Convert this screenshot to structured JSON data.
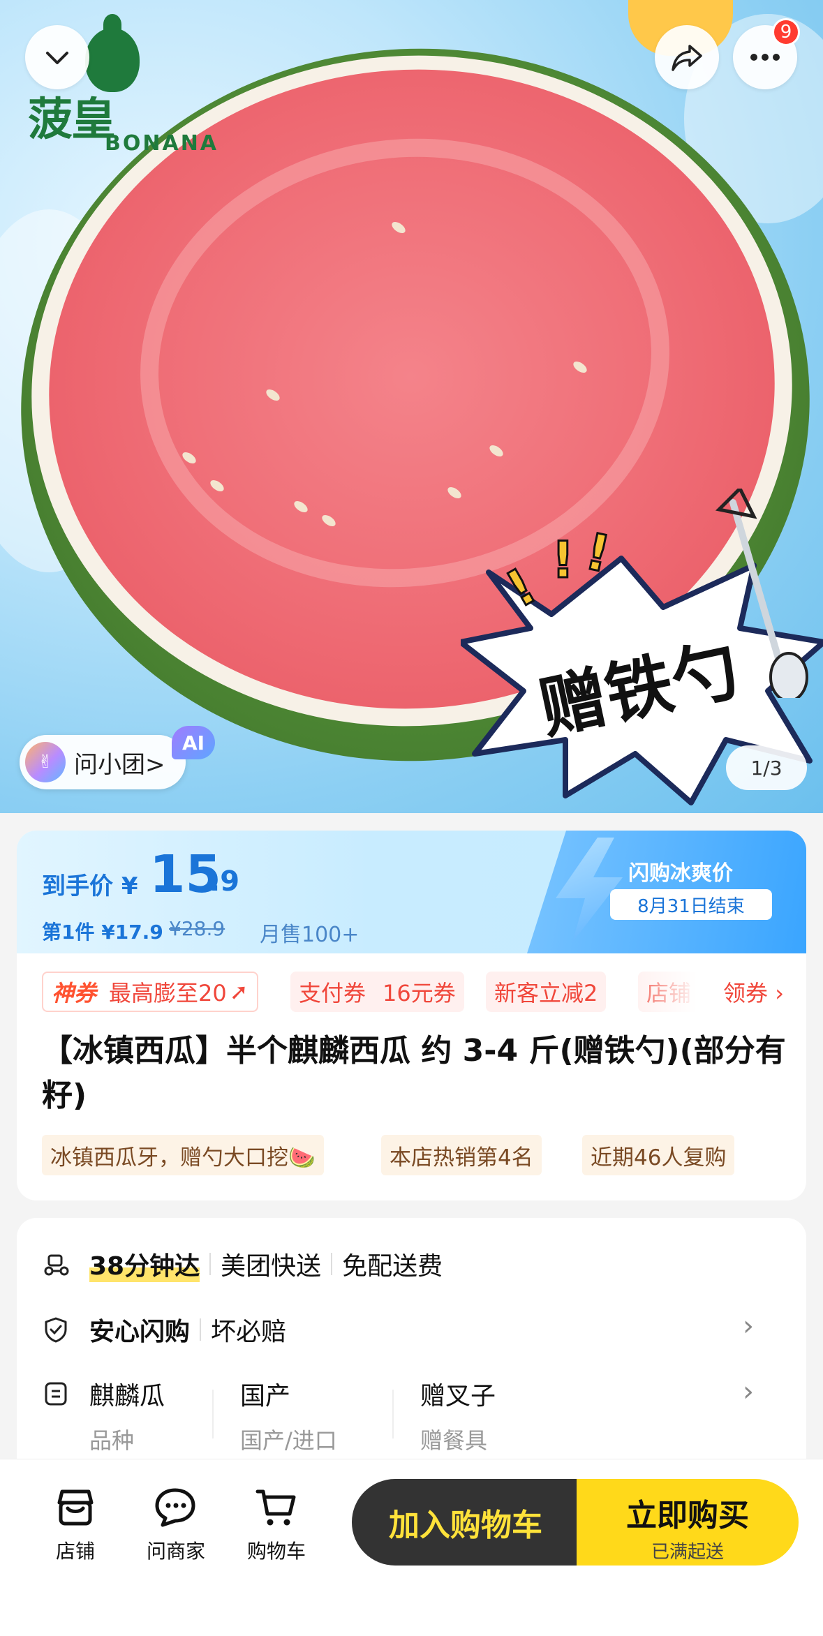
{
  "hero": {
    "brand_cn": "菠皇",
    "brand_en": "BONANA",
    "notification_count": "9",
    "promo_sticker": "赠铁勺",
    "ai_assistant_label": "问小团>",
    "ai_tag": "AI",
    "image_pager": "1/3"
  },
  "price": {
    "label": "到手价",
    "currency": "¥",
    "integer": "15",
    "decimal": ".9",
    "first_piece": "第1件 ¥17.9",
    "original": "¥28.9",
    "monthly_sales": "月售100+",
    "flash_title": "闪购冰爽价",
    "flash_end": "8月31日结束"
  },
  "coupons": {
    "god_tag": "神券",
    "god_text": "最高膨至20",
    "pay_coupon": "支付券",
    "pay_amount": "16元券",
    "new_customer": "新客立减2",
    "store": "店铺",
    "claim": "领券 ›"
  },
  "product": {
    "title": "【冰镇西瓜】半个麒麟西瓜 约 3-4 斤(赠铁勺)(部分有籽)",
    "tags": [
      "冰镇西瓜牙，赠勺大口挖🍉",
      "本店热销第4名",
      "近期46人复购"
    ]
  },
  "delivery": {
    "time": "38分钟达",
    "service": "美团快送",
    "fee": "免配送费"
  },
  "guarantee": {
    "title": "安心闪购",
    "detail": "坏必赔"
  },
  "specs": [
    {
      "value": "麒麟瓜",
      "label": "品种"
    },
    {
      "value": "国产",
      "label": "国产/进口"
    },
    {
      "value": "赠叉子",
      "label": "赠餐具"
    }
  ],
  "bottom_bar": {
    "store": "店铺",
    "ask_merchant": "问商家",
    "cart": "购物车",
    "add_to_cart": "加入购物车",
    "buy_now": "立即购买",
    "buy_sub": "已满起送"
  },
  "colors": {
    "accent_blue": "#1a74d8",
    "coupon_red": "#f0473b",
    "buy_yellow": "#ffd91a",
    "cart_dark": "#333333"
  }
}
